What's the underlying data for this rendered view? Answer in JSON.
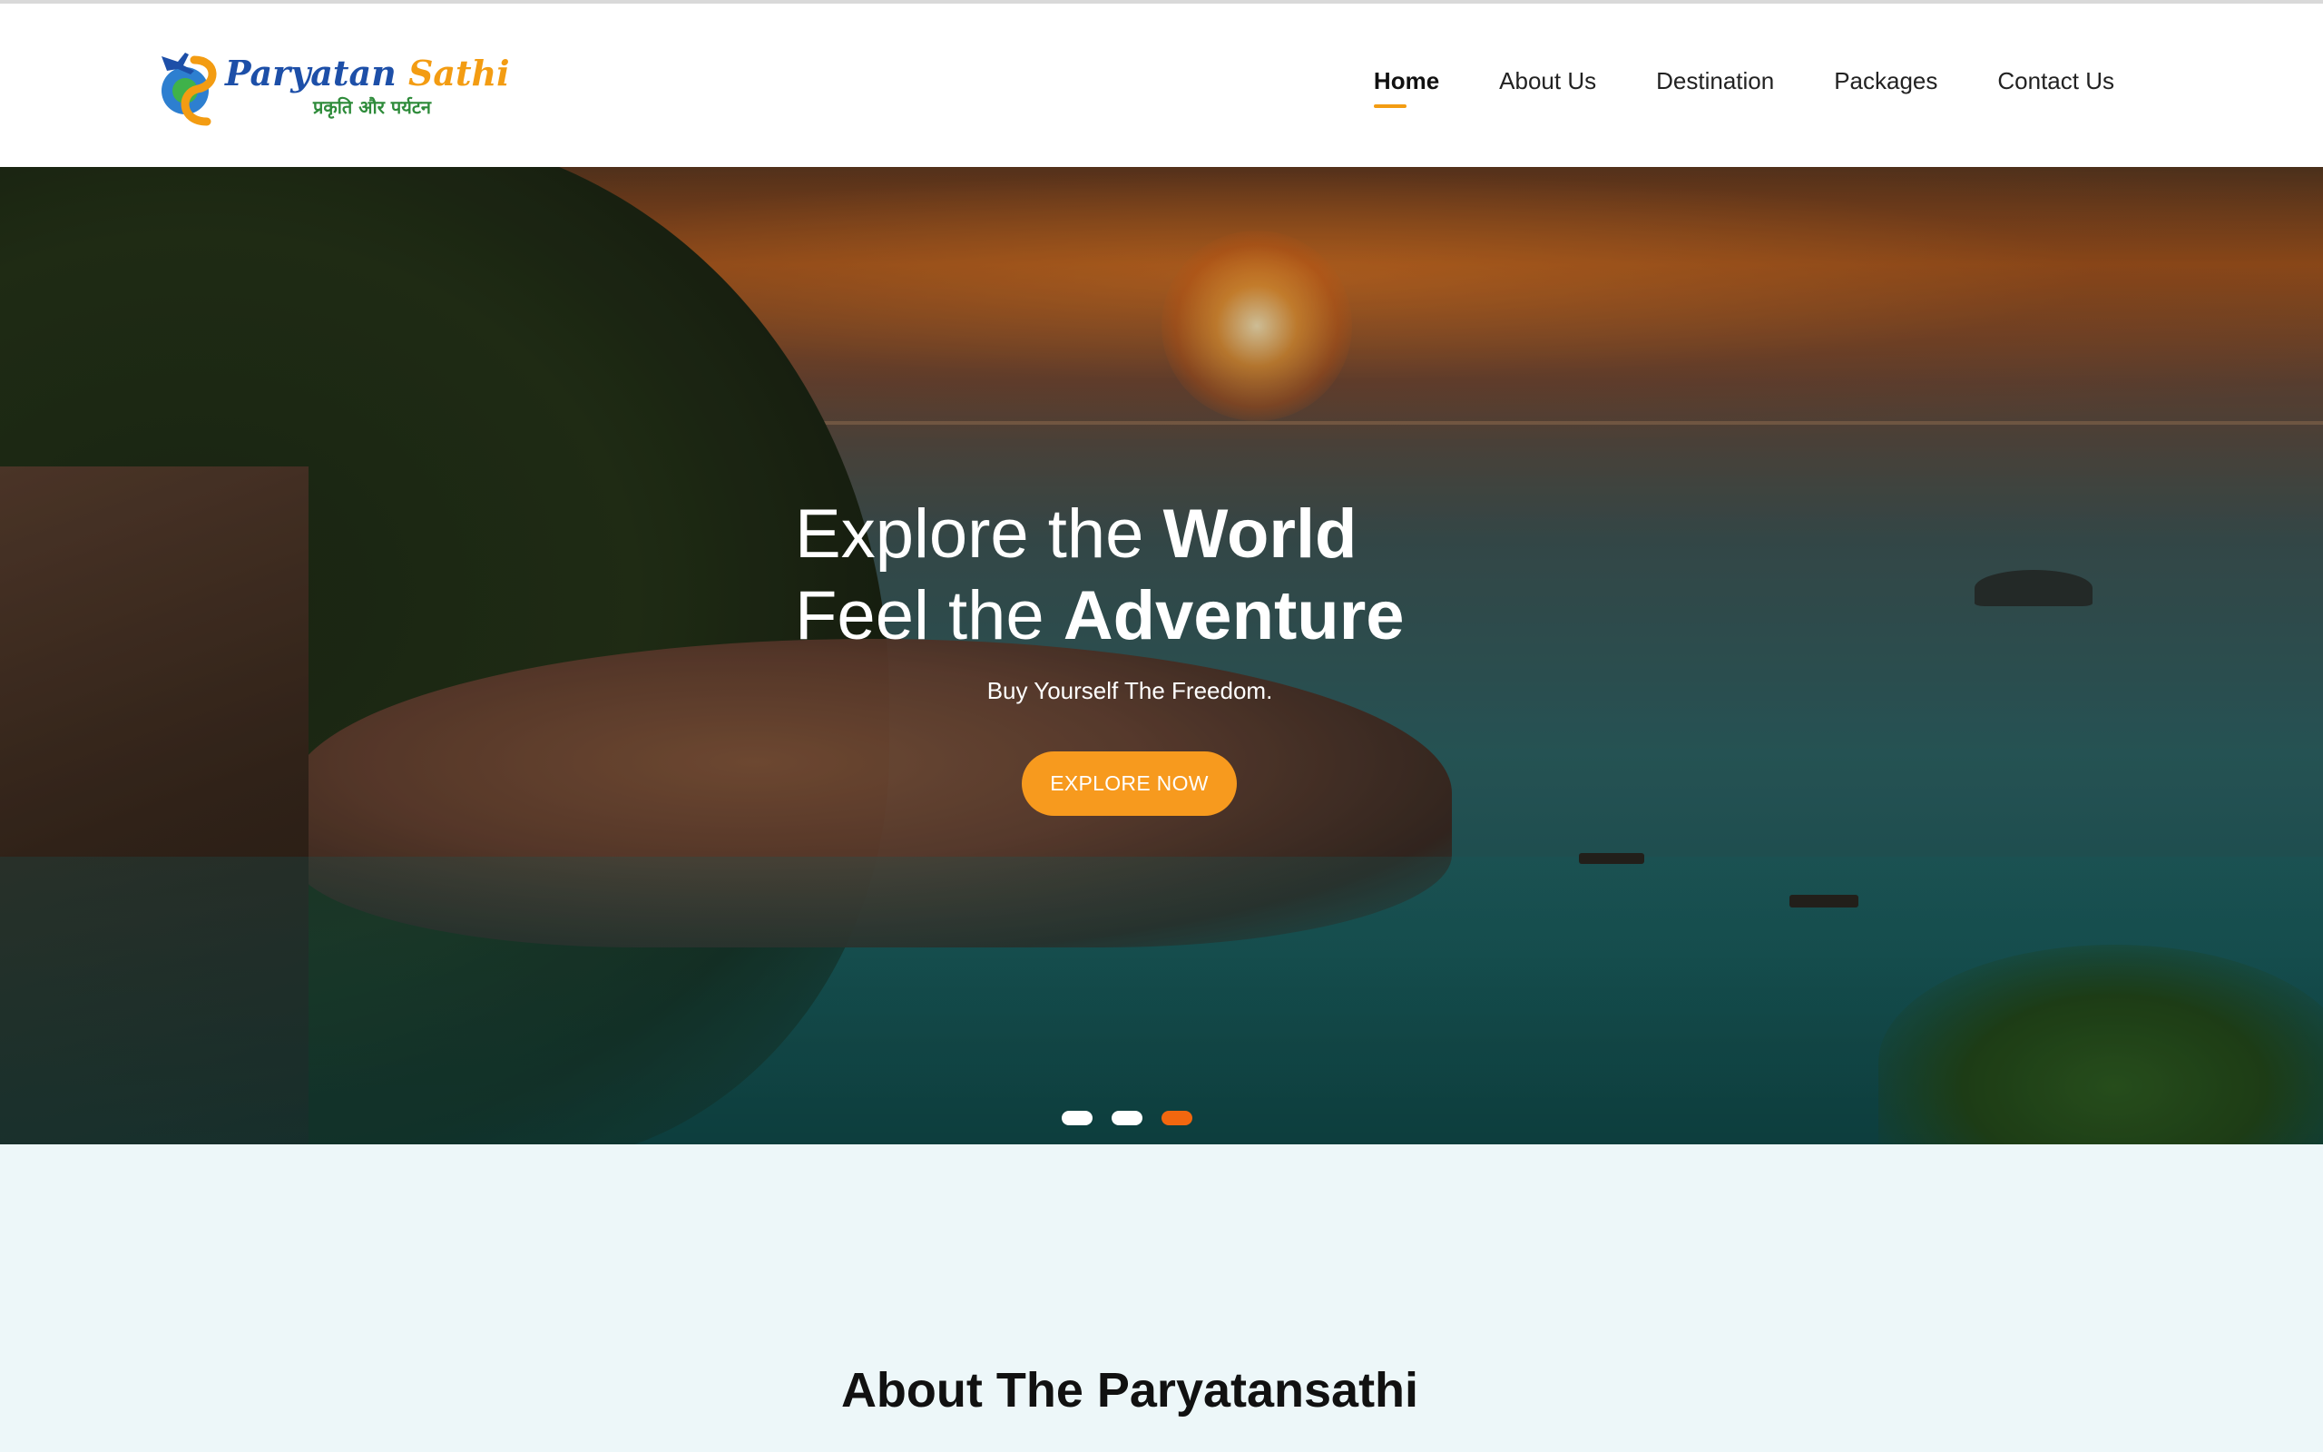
{
  "header": {
    "logo": {
      "brand_part1": "Paryatan",
      "brand_part2": "Sathi",
      "tagline": "प्रकृति और पर्यटन"
    },
    "nav": [
      {
        "label": "Home",
        "active": true
      },
      {
        "label": "About Us",
        "active": false
      },
      {
        "label": "Destination",
        "active": false
      },
      {
        "label": "Packages",
        "active": false
      },
      {
        "label": "Contact Us",
        "active": false
      }
    ]
  },
  "hero": {
    "line1_light": "Explore the ",
    "line1_bold": "World",
    "line2_light": "Feel the ",
    "line2_bold": "Adventure",
    "subtitle": "Buy Yourself The Freedom.",
    "cta_label": "EXPLORE NOW",
    "slides": {
      "count": 3,
      "active_index": 2
    }
  },
  "about": {
    "title": "About The Paryatansathi"
  },
  "colors": {
    "accent": "#f79a1e",
    "active_dot": "#f2670f",
    "section_bg": "#edf7f9"
  }
}
